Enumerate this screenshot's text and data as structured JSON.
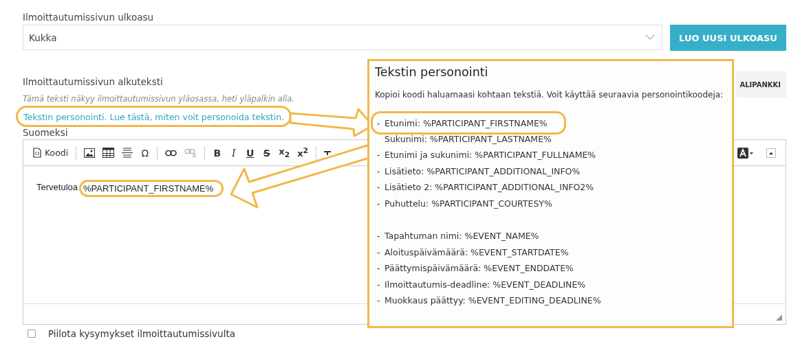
{
  "layout_field": {
    "label": "Ilmoittautumissivun ulkoasu",
    "value": "Kukka"
  },
  "new_layout_button": "LUO UUSI ULKOASU",
  "intro_section": {
    "label": "Ilmoittautumissivun alkuteksti",
    "hint": "Tämä teksti näkyy ilmoittautumissivun yläosassa, heti yläpalkin alla.",
    "link": {
      "text": "Tekstin personointi. Lue tästä, miten voit personoida tekstin.",
      "highlighted": true
    }
  },
  "image_bank_button": "ALIPANKKI",
  "editor": {
    "language_label": "Suomeksi",
    "toolbar": [
      {
        "kind": "code",
        "label": "Koodi",
        "disabled": false
      },
      {
        "kind": "separator"
      },
      {
        "kind": "image",
        "disabled": false
      },
      {
        "kind": "table",
        "disabled": false
      },
      {
        "kind": "rule",
        "disabled": false
      },
      {
        "kind": "glyph",
        "label": "Ω",
        "disabled": false
      },
      {
        "kind": "separator"
      },
      {
        "kind": "link",
        "disabled": false
      },
      {
        "kind": "unlink",
        "disabled": true
      },
      {
        "kind": "separator"
      },
      {
        "kind": "bold",
        "label": "B",
        "disabled": false
      },
      {
        "kind": "italic",
        "label": "I",
        "disabled": false
      },
      {
        "kind": "underline",
        "label": "U",
        "disabled": false
      },
      {
        "kind": "strike",
        "label": "S",
        "disabled": false
      },
      {
        "kind": "script",
        "label": "x$_{2}$",
        "disabled": false
      },
      {
        "kind": "script",
        "label": "x$^{2}$",
        "disabled": false
      },
      {
        "kind": "separator"
      },
      {
        "kind": "clear",
        "disabled": false
      }
    ],
    "toolbar_right": [
      {
        "kind": "color",
        "disabled": false
      },
      {
        "kind": "collapse",
        "disabled": false
      }
    ],
    "content": [
      {
        "text": "Tervetuloa",
        "highlighted": false
      },
      {
        "text": "%PARTICIPANT_FIRSTNAME%",
        "highlighted": true
      }
    ]
  },
  "hide_questions": {
    "label": "Piilota kysymykset ilmoittautumissivulta",
    "checked": false
  },
  "popup": {
    "title": "Tekstin personointi",
    "intro": "Kopioi koodi haluamaasi kohtaan tekstiä. Voit käyttää seuraavia personointikoodeja:",
    "groups": [
      [
        {
          "marker": "-",
          "text": "Etunimi: %PARTICIPANT_FIRSTNAME%",
          "highlighted": true
        },
        {
          "text": "Sukunimi: %PARTICIPANT_LASTNAME%",
          "highlighted": false
        },
        {
          "marker": "-",
          "text": "Etunimi ja sukunimi: %PARTICIPANT_FULLNAME%",
          "highlighted": false
        },
        {
          "marker": "-",
          "text": "Lisätieto: %PARTICIPANT_ADDITIONAL_INFO%",
          "highlighted": false
        },
        {
          "marker": "-",
          "text": "Lisätieto 2: %PARTICIPANT_ADDITIONAL_INFO2%",
          "highlighted": false
        },
        {
          "marker": "-",
          "text": "Puhuttelu: %PARTICIPANT_COURTESY%",
          "highlighted": false
        }
      ],
      [
        {
          "marker": "-",
          "text": "Tapahtuman nimi: %EVENT_NAME%",
          "highlighted": false
        },
        {
          "marker": "-",
          "text": "Aloituspäivämäärä: %EVENT_STARTDATE%",
          "highlighted": false
        },
        {
          "marker": "-",
          "text": "Päättymispäivämäärä: %EVENT_ENDDATE%",
          "highlighted": false
        },
        {
          "marker": "-",
          "text": "Ilmoittautumis-deadline: %EVENT_DEADLINE%",
          "highlighted": false
        },
        {
          "marker": "-",
          "text": "Muokkaus päättyy: %EVENT_EDITING_DEADLINE%",
          "highlighted": false
        }
      ]
    ]
  }
}
